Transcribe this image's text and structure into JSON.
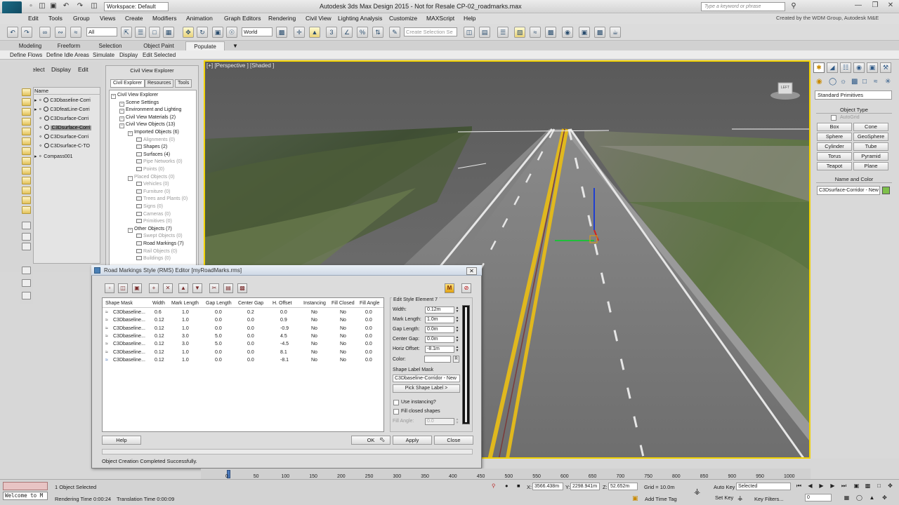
{
  "titlebar": {
    "workspace": "Workspace: Default",
    "app_title": "Autodesk 3ds Max Design 2015  -  Not for Resale   CP-02_roadmarks.max",
    "search_placeholder": "Type a keyword or phrase",
    "logo_text": "MAX"
  },
  "menu": [
    "Edit",
    "Tools",
    "Group",
    "Views",
    "Create",
    "Modifiers",
    "Animation",
    "Graph Editors",
    "Rendering",
    "Civil View",
    "Lighting Analysis",
    "Customize",
    "MAXScript",
    "Help"
  ],
  "credit": "Created by the WDM Group, Autodesk M&E",
  "toolbar": {
    "selection_filter": "All",
    "ref_coord": "World",
    "named_selection": "Create Selection Se"
  },
  "ribbon": {
    "tabs": [
      "Modeling",
      "Freeform",
      "Selection",
      "Object Paint",
      "Populate"
    ],
    "active_tab": "Populate",
    "sub": [
      "Define Flows",
      "Define Idle Areas",
      "Simulate",
      "Display",
      "Edit Selected"
    ]
  },
  "scene_explorer": {
    "tabs": [
      "Select",
      "Display",
      "Edit"
    ],
    "column": "Name",
    "items": [
      "C3Dbaseline-Corri",
      "C3DfeatLine-Corri",
      "C3Dsurface-Corri",
      "C3Dsurface-Corri",
      "C3Dsurface-Corri",
      "C3Dsurface-Corri",
      "C3Dsurface-C-TO",
      "Compass001"
    ]
  },
  "civil_explorer": {
    "title": "Civil View Explorer",
    "tabs": [
      "Civil Explorer",
      "Resources",
      "Tools"
    ],
    "tree": [
      {
        "label": "Civil View Explorer",
        "depth": 0,
        "dim": false
      },
      {
        "label": "Scene Settings",
        "depth": 1,
        "dim": false
      },
      {
        "label": "Environment and Lighting",
        "depth": 1,
        "dim": false
      },
      {
        "label": "Civil View Materials (2)",
        "depth": 1,
        "dim": false
      },
      {
        "label": "Civil View Objects (13)",
        "depth": 1,
        "dim": false
      },
      {
        "label": "Imported Objects (6)",
        "depth": 2,
        "dim": false
      },
      {
        "label": "Alignments (0)",
        "depth": 3,
        "dim": true
      },
      {
        "label": "Shapes (2)",
        "depth": 3,
        "dim": false
      },
      {
        "label": "Surfaces (4)",
        "depth": 3,
        "dim": false
      },
      {
        "label": "Pipe Networks (0)",
        "depth": 3,
        "dim": true
      },
      {
        "label": "Points (0)",
        "depth": 3,
        "dim": true
      },
      {
        "label": "Placed Objects (0)",
        "depth": 2,
        "dim": true
      },
      {
        "label": "Vehicles (0)",
        "depth": 3,
        "dim": true
      },
      {
        "label": "Furniture (0)",
        "depth": 3,
        "dim": true
      },
      {
        "label": "Trees and Plants (0)",
        "depth": 3,
        "dim": true
      },
      {
        "label": "Signs (0)",
        "depth": 3,
        "dim": true
      },
      {
        "label": "Cameras (0)",
        "depth": 3,
        "dim": true
      },
      {
        "label": "Primitives (0)",
        "depth": 3,
        "dim": true
      },
      {
        "label": "Other Objects (7)",
        "depth": 2,
        "dim": false
      },
      {
        "label": "Swept Objects (0)",
        "depth": 3,
        "dim": true
      },
      {
        "label": "Road Markings (7)",
        "depth": 3,
        "dim": false
      },
      {
        "label": "Rail Objects (0)",
        "depth": 3,
        "dim": true
      },
      {
        "label": "Buildings (0)",
        "depth": 3,
        "dim": true
      }
    ]
  },
  "viewport": {
    "label": "[+] [Perspective ] [Shaded ]",
    "viewcube_label": "LEFT"
  },
  "command_panel": {
    "primitive_type": "Standard Primitives",
    "object_type_title": "Object Type",
    "autogrid": "AutoGrid",
    "buttons": [
      "Box",
      "Cone",
      "Sphere",
      "GeoSphere",
      "Cylinder",
      "Tube",
      "Torus",
      "Pyramid",
      "Teapot",
      "Plane"
    ],
    "name_color_title": "Name and Color",
    "object_name": "C3Dsurface-Corridor - New",
    "object_color": "#7ec04a"
  },
  "rms_dialog": {
    "title": "Road Markings Style (RMS) Editor [myRoadMarks.rms]",
    "columns": [
      "Shape Mask",
      "Width",
      "Mark Length",
      "Gap Length",
      "Center Gap",
      "H. Offset",
      "Instancing",
      "Fill Closed",
      "Fill Angle"
    ],
    "rows": [
      [
        "C3Dbaseline...",
        "0.6",
        "1.0",
        "0.0",
        "0.2",
        "0.0",
        "No",
        "No",
        "0.0"
      ],
      [
        "C3Dbaseline...",
        "0.12",
        "1.0",
        "0.0",
        "0.0",
        "0.9",
        "No",
        "No",
        "0.0"
      ],
      [
        "C3Dbaseline...",
        "0.12",
        "1.0",
        "0.0",
        "0.0",
        "-0.9",
        "No",
        "No",
        "0.0"
      ],
      [
        "C3Dbaseline...",
        "0.12",
        "3.0",
        "5.0",
        "0.0",
        "4.5",
        "No",
        "No",
        "0.0"
      ],
      [
        "C3Dbaseline...",
        "0.12",
        "3.0",
        "5.0",
        "0.0",
        "-4.5",
        "No",
        "No",
        "0.0"
      ],
      [
        "C3Dbaseline...",
        "0.12",
        "1.0",
        "0.0",
        "0.0",
        "8.1",
        "No",
        "No",
        "0.0"
      ],
      [
        "C3Dbaseline...",
        "0.12",
        "1.0",
        "0.0",
        "0.0",
        "-8.1",
        "No",
        "No",
        "0.0"
      ]
    ],
    "edit_title": "Edit Style Element 7",
    "fields": [
      {
        "label": "Width:",
        "value": "0.12m"
      },
      {
        "label": "Mark Length:",
        "value": "1.0m"
      },
      {
        "label": "Gap Length:",
        "value": "0.0m"
      },
      {
        "label": "Center Gap:",
        "value": "0.0m"
      },
      {
        "label": "Horiz Offset:",
        "value": "-8.1m"
      }
    ],
    "color_label": "Color:",
    "r_label": "R",
    "shape_label_mask_title": "Shape Label Mask",
    "shape_label_mask": "C3Dbaseline-Corridor - New",
    "pick_shape_label": "Pick Shape Label  >",
    "use_instancing": "Use instancing?",
    "fill_closed": "Fill closed shapes",
    "fill_angle_label": "Fill Angle:",
    "fill_angle": "0.0",
    "m_button": "M",
    "buttons": {
      "help": "Help",
      "ok": "OK",
      "apply": "Apply",
      "close": "Close"
    },
    "status": "Object Creation Completed Successfully."
  },
  "timeline": {
    "ticks": [
      "0",
      "50",
      "100",
      "150",
      "200",
      "250",
      "300",
      "350",
      "400",
      "450",
      "500",
      "550",
      "600",
      "650",
      "700",
      "750",
      "800",
      "850",
      "900",
      "950",
      "1000"
    ]
  },
  "statusbar": {
    "maxscript": "Welcome to M",
    "selected": "1 Object Selected",
    "rendering_time": "Rendering Time  0:00:24",
    "translation_time": "Translation Time  0:00:09",
    "x_label": "X:",
    "x": "3566.438m",
    "y_label": "Y:",
    "y": "2298.941m",
    "z_label": "Z:",
    "z": "52.652m",
    "grid": "Grid = 10.0m",
    "add_time_tag": "Add Time Tag",
    "auto_key": "Auto Key",
    "set_key": "Set Key",
    "selected_dd": "Selected",
    "key_filters": "Key Filters...",
    "frame": "0"
  }
}
